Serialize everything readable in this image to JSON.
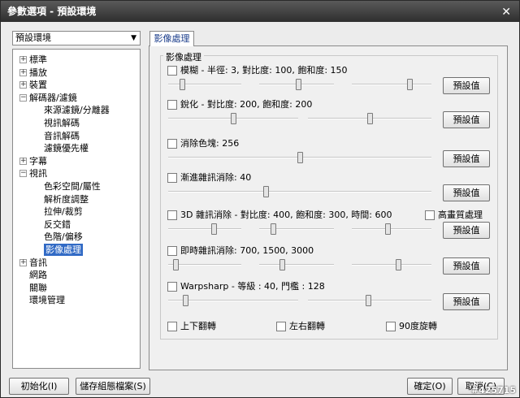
{
  "window": {
    "title": "參數選項 - 預設環境",
    "close_icon": "✕"
  },
  "profile": {
    "value": "預設環境"
  },
  "tree": [
    {
      "label": "標準",
      "exp": "+"
    },
    {
      "label": "播放",
      "exp": "+"
    },
    {
      "label": "裝置",
      "exp": "+"
    },
    {
      "label": "解碼器/濾鏡",
      "exp": "−"
    },
    {
      "label": "來源濾鏡/分離器"
    },
    {
      "label": "視訊解碼"
    },
    {
      "label": "音訊解碼"
    },
    {
      "label": "濾鏡優先權"
    },
    {
      "label": "字幕",
      "exp": "+"
    },
    {
      "label": "視訊",
      "exp": "−"
    },
    {
      "label": "色彩空間/屬性"
    },
    {
      "label": "解析度調整"
    },
    {
      "label": "拉伸/裁剪"
    },
    {
      "label": "反交錯"
    },
    {
      "label": "色階/偏移"
    },
    {
      "label": "影像處理"
    },
    {
      "label": "音訊",
      "exp": "+"
    },
    {
      "label": "網路"
    },
    {
      "label": "關聯"
    },
    {
      "label": "環境管理"
    }
  ],
  "tab": {
    "label": "影像處理"
  },
  "group": {
    "label": "影像處理"
  },
  "filters": [
    {
      "label": "模糊 - 半徑: 3, 對比度: 100, 飽和度: 150",
      "button": "預設值",
      "sliders": [
        0.19,
        0.52,
        0.72
      ]
    },
    {
      "label": "銳化 - 對比度: 200, 飽和度: 200",
      "button": "預設值",
      "sliders": [
        0.5,
        0.5
      ]
    },
    {
      "label": "消除色塊: 256",
      "button": "預設值",
      "sliders": [
        0.5
      ]
    },
    {
      "label": "漸進雜訊消除: 40",
      "button": "預設值",
      "sliders": [
        0.37
      ]
    },
    {
      "label": "3D 雜訊消除 - 對比度: 400, 飽和度: 300, 時間: 600",
      "extra": "高畫質處理",
      "button": "預設值",
      "sliders": [
        0.62,
        0.18,
        0.45
      ]
    },
    {
      "label": "即時雜訊消除: 700, 1500, 3000",
      "button": "預設值",
      "sliders": [
        0.1,
        0.3,
        0.58
      ]
    },
    {
      "label": "Warpsharp - 等級 : 40, 門檻 : 128",
      "button": "預設值",
      "sliders": [
        0.13,
        0.49
      ]
    }
  ],
  "flips": [
    "上下翻轉",
    "左右翻轉",
    "90度旋轉"
  ],
  "footer": {
    "init": "初始化(I)",
    "save": "儲存組態檔案(S)",
    "ok": "確定(O)",
    "cancel": "取消(C)"
  },
  "watermark": "#425715"
}
